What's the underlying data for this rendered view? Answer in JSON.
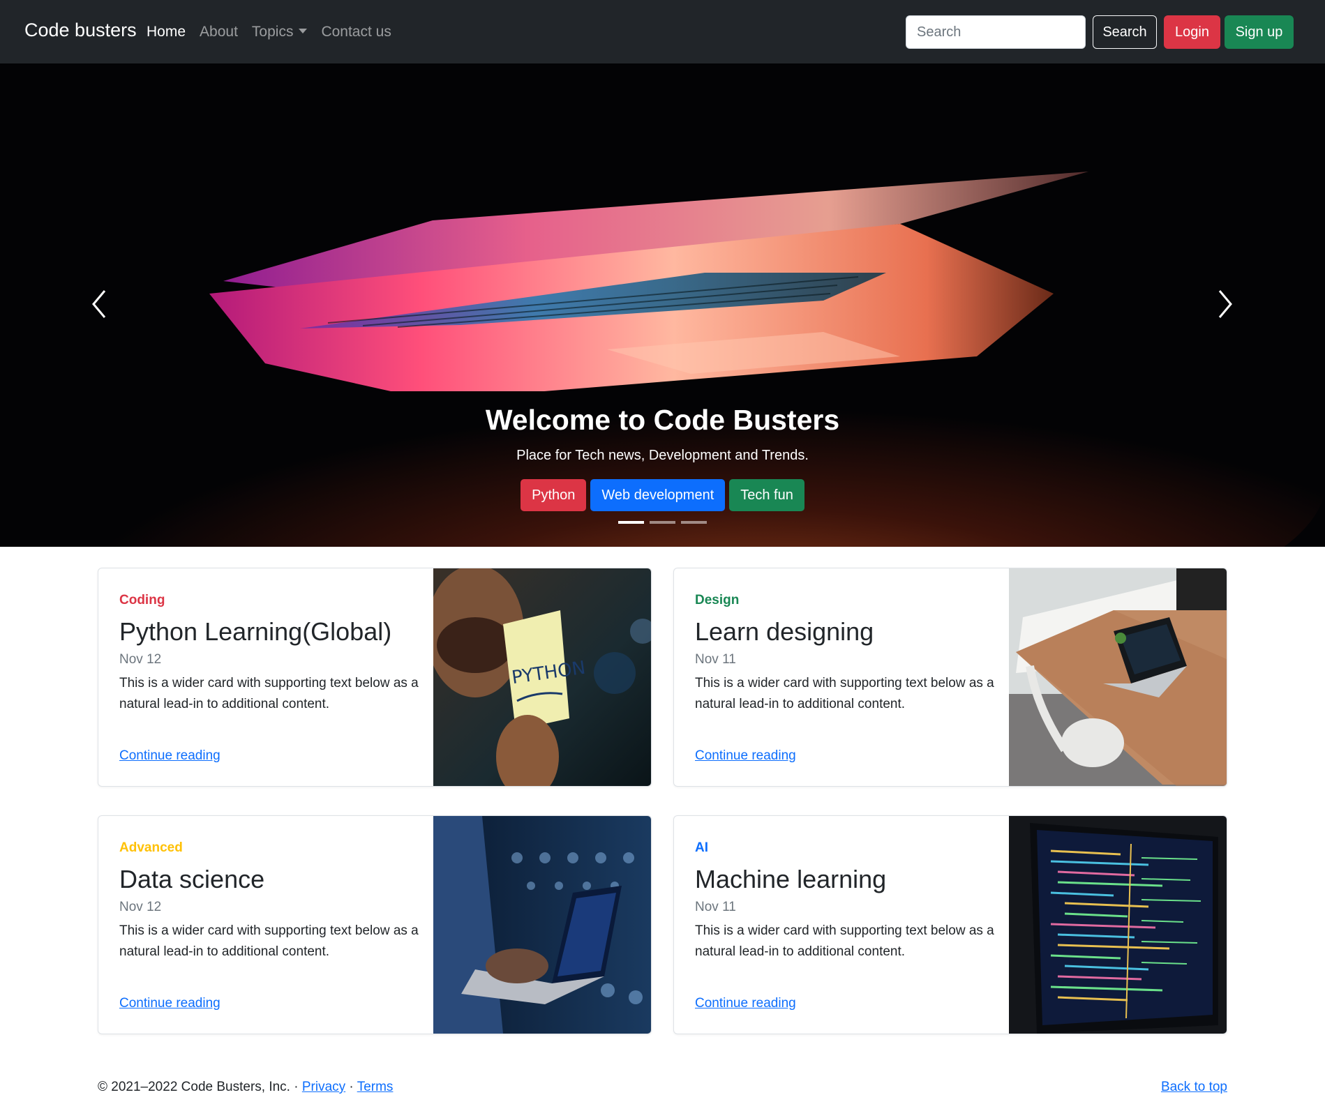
{
  "navbar": {
    "brand": "Code busters",
    "links": [
      {
        "label": "Home",
        "active": true
      },
      {
        "label": "About",
        "active": false
      },
      {
        "label": "Topics",
        "active": false,
        "dropdown": true
      },
      {
        "label": "Contact us",
        "active": false
      }
    ],
    "search_placeholder": "Search",
    "search_button": "Search",
    "login_button": "Login",
    "signup_button": "Sign up"
  },
  "carousel": {
    "title": "Welcome to Code Busters",
    "subtitle": "Place for Tech news, Development and Trends.",
    "buttons": [
      {
        "label": "Python",
        "color": "#dc3545"
      },
      {
        "label": "Web development",
        "color": "#0d6efd"
      },
      {
        "label": "Tech fun",
        "color": "#198754"
      }
    ],
    "slide_count": 3,
    "active_slide": 0
  },
  "cards": [
    {
      "category": "Coding",
      "category_color": "#dc3545",
      "title": "Python Learning(Global)",
      "date": "Nov 12",
      "text": "This is a wider card with supporting text below as a natural lead-in to additional content.",
      "link": "Continue reading"
    },
    {
      "category": "Design",
      "category_color": "#198754",
      "title": "Learn designing",
      "date": "Nov 11",
      "text": "This is a wider card with supporting text below as a natural lead-in to additional content.",
      "link": "Continue reading"
    },
    {
      "category": "Advanced",
      "category_color": "#ffc107",
      "title": "Data science",
      "date": "Nov 12",
      "text": "This is a wider card with supporting text below as a natural lead-in to additional content.",
      "link": "Continue reading"
    },
    {
      "category": "AI",
      "category_color": "#0d6efd",
      "title": "Machine learning",
      "date": "Nov 11",
      "text": "This is a wider card with supporting text below as a natural lead-in to additional content.",
      "link": "Continue reading"
    }
  ],
  "footer": {
    "copyright": "© 2021–2022 Code Busters, Inc. · ",
    "privacy": "Privacy",
    "separator": " · ",
    "terms": "Terms",
    "back_to_top": "Back to top"
  }
}
